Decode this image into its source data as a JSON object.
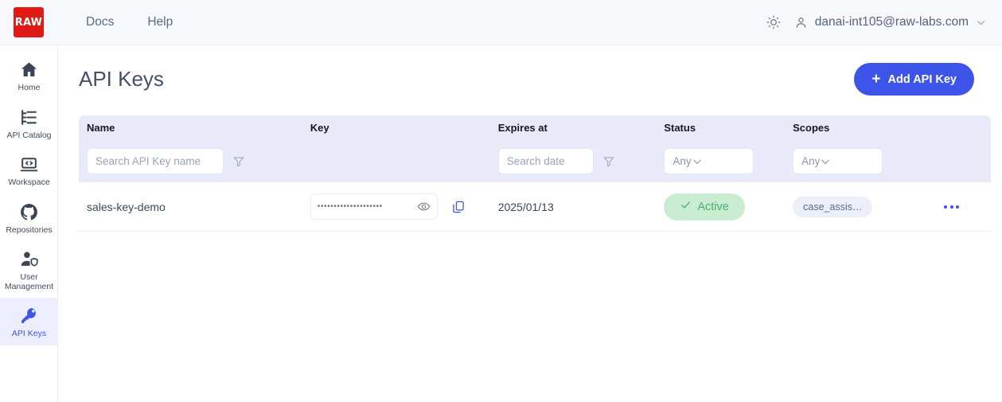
{
  "header": {
    "logo_text": "RAW",
    "nav": [
      {
        "label": "Docs"
      },
      {
        "label": "Help"
      }
    ],
    "theme_icon": "sun-icon",
    "user_icon": "person-icon",
    "user_email": "danai-int105@raw-labs.com",
    "user_chevron": "chevron-down-icon"
  },
  "sidebar": {
    "items": [
      {
        "label": "Home",
        "icon": "home-icon",
        "active": false
      },
      {
        "label": "API Catalog",
        "icon": "catalog-icon",
        "active": false
      },
      {
        "label": "Workspace",
        "icon": "laptop-code-icon",
        "active": false
      },
      {
        "label": "Repositories",
        "icon": "github-icon",
        "active": false
      },
      {
        "label": "User Management",
        "icon": "user-shield-icon",
        "active": false
      },
      {
        "label": "API Keys",
        "icon": "key-icon",
        "active": true
      }
    ]
  },
  "main": {
    "page_title": "API Keys",
    "add_button": {
      "label": "Add API Key",
      "icon": "plus-icon"
    }
  },
  "table": {
    "columns": [
      {
        "key": "name",
        "label": "Name"
      },
      {
        "key": "key",
        "label": "Key"
      },
      {
        "key": "expires_at",
        "label": "Expires at"
      },
      {
        "key": "status",
        "label": "Status"
      },
      {
        "key": "scopes",
        "label": "Scopes"
      }
    ],
    "filters": {
      "name_placeholder": "Search API Key name",
      "name_value": "",
      "name_filter_icon": "filter-icon",
      "date_placeholder": "Search date",
      "date_value": "",
      "date_filter_icon": "filter-icon",
      "status_value": "Any",
      "scopes_value": "Any"
    },
    "rows": [
      {
        "name": "sales-key-demo",
        "key_masked": "••••••••••••••••••••",
        "key_reveal_icon": "eye-icon",
        "key_copy_icon": "copy-icon",
        "expires_at": "2025/01/13",
        "status": "Active",
        "status_icon": "check-icon",
        "scopes": "case_assis…",
        "more_icon": "more-horizontal-icon"
      }
    ]
  },
  "colors": {
    "brand_red": "#e01b15",
    "accent_blue": "#3d54e8",
    "header_bg": "#f7f8fc",
    "table_header_bg": "#e8eaf9",
    "status_active_bg": "#c9ecd0",
    "status_active_text": "#4caf72",
    "chip_bg": "#eceefa",
    "active_nav_bg": "#eceefd"
  }
}
